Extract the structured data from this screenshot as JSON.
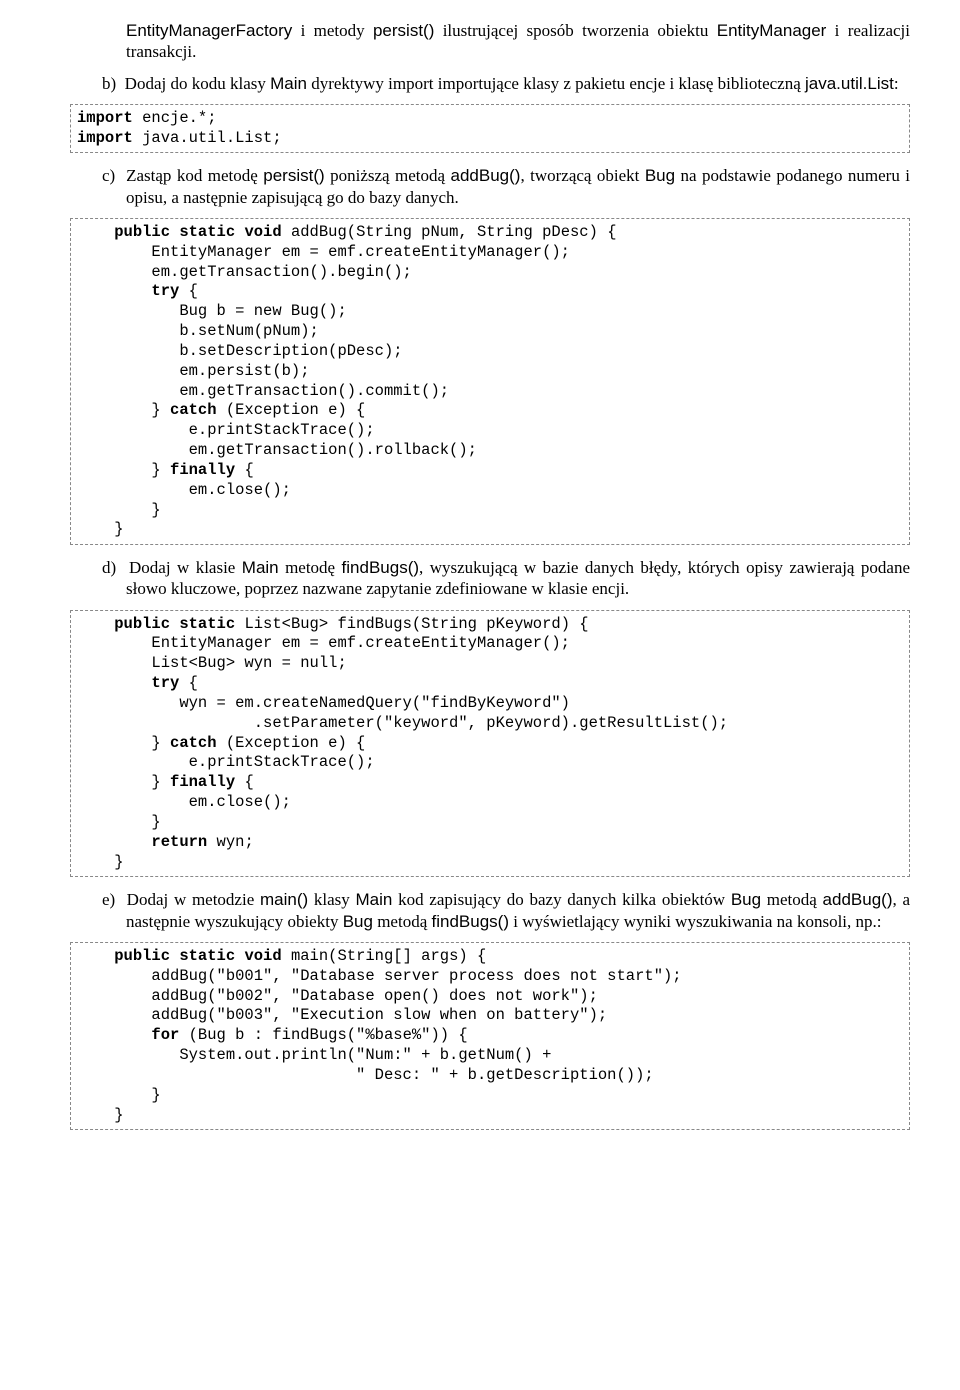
{
  "p_intro1": "EntityManagerFactory",
  "p_intro2": " i metody ",
  "p_intro3": "persist()",
  "p_intro4": " ilustrującej sposób tworzenia obiektu ",
  "p_intro5": "EntityManager",
  "p_intro6": " i realizacji transakcji.",
  "b_label": "b)",
  "b_1": "Dodaj do kodu klasy ",
  "b_2": "Main",
  "b_3": " dyrektywy import importujące klasy z pakietu encje i klasę biblioteczną ",
  "b_4": "java.util.List",
  "b_5": ":",
  "code_b_kw1": "import",
  "code_b_t1": " encje.*;\n",
  "code_b_kw2": "import",
  "code_b_t2": " java.util.List;",
  "c_label": "c)",
  "c_1": "Zastąp kod metodę ",
  "c_2": "persist()",
  "c_3": " poniższą metodą ",
  "c_4": "addBug()",
  "c_5": ", tworzącą obiekt ",
  "c_6": "Bug",
  "c_7": " na podstawie podanego numeru i opisu, a następnie zapisującą go do bazy danych.",
  "code_c_1": "    ",
  "code_c_kw1": "public static void",
  "code_c_2": " addBug(String pNum, String pDesc) {\n        EntityManager em = emf.createEntityManager();\n        em.getTransaction().begin();\n        ",
  "code_c_kw2": "try",
  "code_c_3": " {\n           Bug b = new Bug();\n           b.setNum(pNum);\n           b.setDescription(pDesc);\n           em.persist(b);\n           em.getTransaction().commit();\n        } ",
  "code_c_kw3": "catch",
  "code_c_4": " (Exception e) {\n            e.printStackTrace();\n            em.getTransaction().rollback();\n        } ",
  "code_c_kw4": "finally",
  "code_c_5": " {\n            em.close();\n        }\n    }",
  "d_label": "d)",
  "d_1": "Dodaj w klasie ",
  "d_2": "Main",
  "d_3": " metodę ",
  "d_4": "findBugs()",
  "d_5": ", wyszukującą w bazie danych błędy, których opisy zawierają podane słowo kluczowe, poprzez nazwane zapytanie zdefiniowane w klasie encji.",
  "code_d_1": "    ",
  "code_d_kw1": "public static",
  "code_d_2": " List<Bug> findBugs(String pKeyword) {\n        EntityManager em = emf.createEntityManager();\n        List<Bug> wyn = null;\n        ",
  "code_d_kw2": "try",
  "code_d_3": " {\n           wyn = em.createNamedQuery(\"findByKeyword\")\n                   .setParameter(\"keyword\", pKeyword).getResultList();\n        } ",
  "code_d_kw3": "catch",
  "code_d_4": " (Exception e) {\n            e.printStackTrace();\n        } ",
  "code_d_kw4": "finally",
  "code_d_5": " {\n            em.close();\n        }\n        ",
  "code_d_kw5": "return",
  "code_d_6": " wyn;\n    }",
  "e_label": "e)",
  "e_1": "Dodaj w metodzie ",
  "e_2": "main()",
  "e_3": " klasy ",
  "e_4": "Main",
  "e_5": " kod zapisujący do bazy danych kilka obiektów ",
  "e_6": "Bug",
  "e_7": " metodą ",
  "e_8": "addBug()",
  "e_9": ", a następnie wyszukujący obiekty ",
  "e_10": "Bug",
  "e_11": " metodą ",
  "e_12": "findBugs()",
  "e_13": " i wyświetlający wyniki wyszukiwania na konsoli, np.:",
  "code_e_1": "    ",
  "code_e_kw1": "public static void",
  "code_e_2": " main(String[] args) {\n        addBug(\"b001\", \"Database server process does not start\");\n        addBug(\"b002\", \"Database open() does not work\");\n        addBug(\"b003\", \"Execution slow when on battery\");\n        ",
  "code_e_kw2": "for",
  "code_e_3": " (Bug b : findBugs(\"%base%\")) {\n           System.out.println(\"Num:\" + b.getNum() +\n                              \" Desc: \" + b.getDescription());\n        }\n    }"
}
